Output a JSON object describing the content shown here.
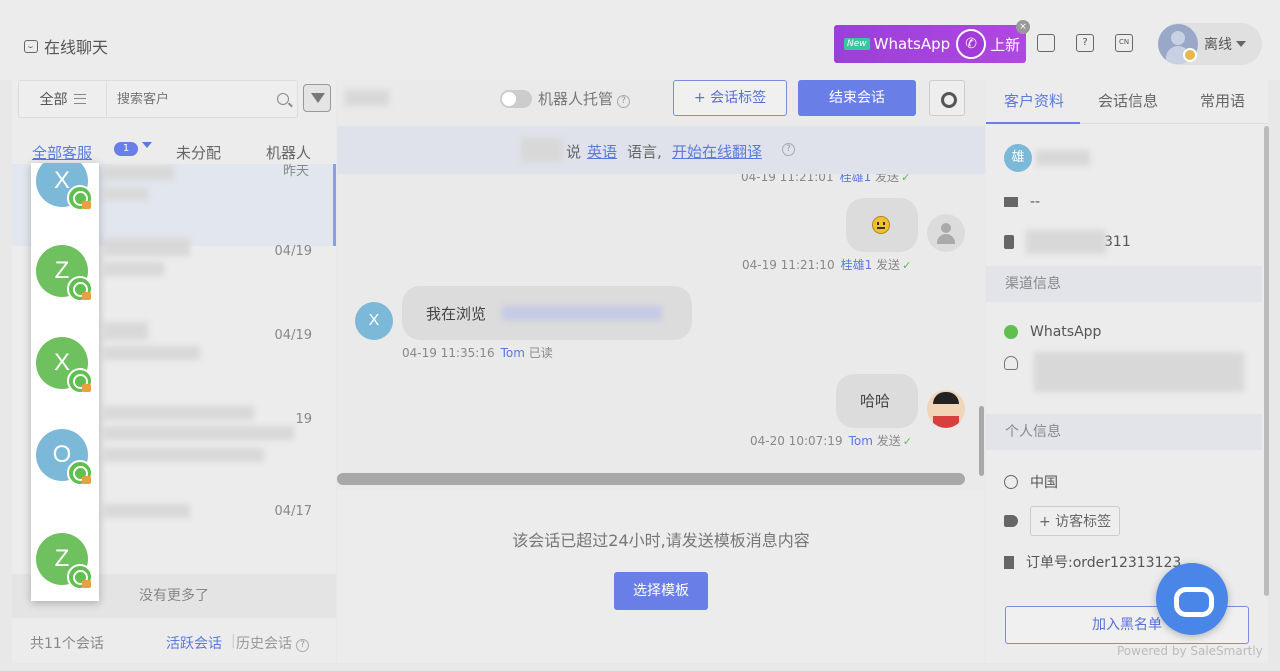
{
  "header": {
    "title": "在线聊天",
    "banner": {
      "new_tag": "New",
      "brand": "WhatsApp",
      "label": "上新"
    },
    "lang_icon_text": "CN",
    "help_icon_text": "?",
    "user": {
      "status": "离线"
    }
  },
  "sidebar": {
    "filter_label": "全部",
    "search_placeholder": "搜索客户",
    "tabs": [
      {
        "label": "全部客服",
        "badge": "1"
      },
      {
        "label": "未分配"
      },
      {
        "label": "机器人"
      }
    ],
    "conversations": [
      {
        "time": "昨天",
        "initial": "X",
        "color": "#7cb8d8"
      },
      {
        "time": "04/19",
        "initial": "Z",
        "color": "#6fc05f"
      },
      {
        "time": "04/19",
        "initial": "X",
        "color": "#6fc05f"
      },
      {
        "time": "19",
        "initial": "O",
        "color": "#7cb8d8"
      },
      {
        "time": "04/17",
        "initial": "Z",
        "color": "#6fc05f"
      }
    ],
    "no_more": "没有更多了",
    "footer": {
      "count": "共11个会话",
      "active": "活跃会话",
      "history": "历史会话"
    }
  },
  "chat": {
    "robot_label": "机器人托管",
    "tag_button": "+ 会话标签",
    "end_button": "结束会话",
    "translate": {
      "says": "说",
      "lang": "英语",
      "lang_suffix": "语言,",
      "start": "开始在线翻译"
    },
    "messages": [
      {
        "text": "",
        "meta_time": "04-19 11:21:10",
        "meta_who": "桂雄1",
        "meta_status": "发送"
      },
      {
        "text": "我在浏览",
        "meta_time": "04-19 11:35:16",
        "meta_who": "Tom",
        "meta_status": "已读"
      },
      {
        "text": "哈哈",
        "meta_time": "04-20 10:07:19",
        "meta_who": "Tom",
        "meta_status": "发送"
      }
    ],
    "partial_meta": {
      "time": "04-19 11:21:01",
      "who": "桂雄1",
      "status": "发送"
    },
    "customer_initial": "X",
    "notice": "该会话已超过24小时,请发送模板消息内容",
    "template_button": "选择模板"
  },
  "profile": {
    "tabs": [
      "客户资料",
      "会话信息",
      "常用语"
    ],
    "name_initial": "雄",
    "email": "--",
    "phone_suffix": "311",
    "channel_section": "渠道信息",
    "channel": "WhatsApp",
    "personal_section": "个人信息",
    "country": "中国",
    "visitor_tag_button": "+ 访客标签",
    "order": "订单号:order12313123",
    "blacklist_button": "加入黑名单"
  },
  "powered_by": "Powered by SaleSmartly"
}
